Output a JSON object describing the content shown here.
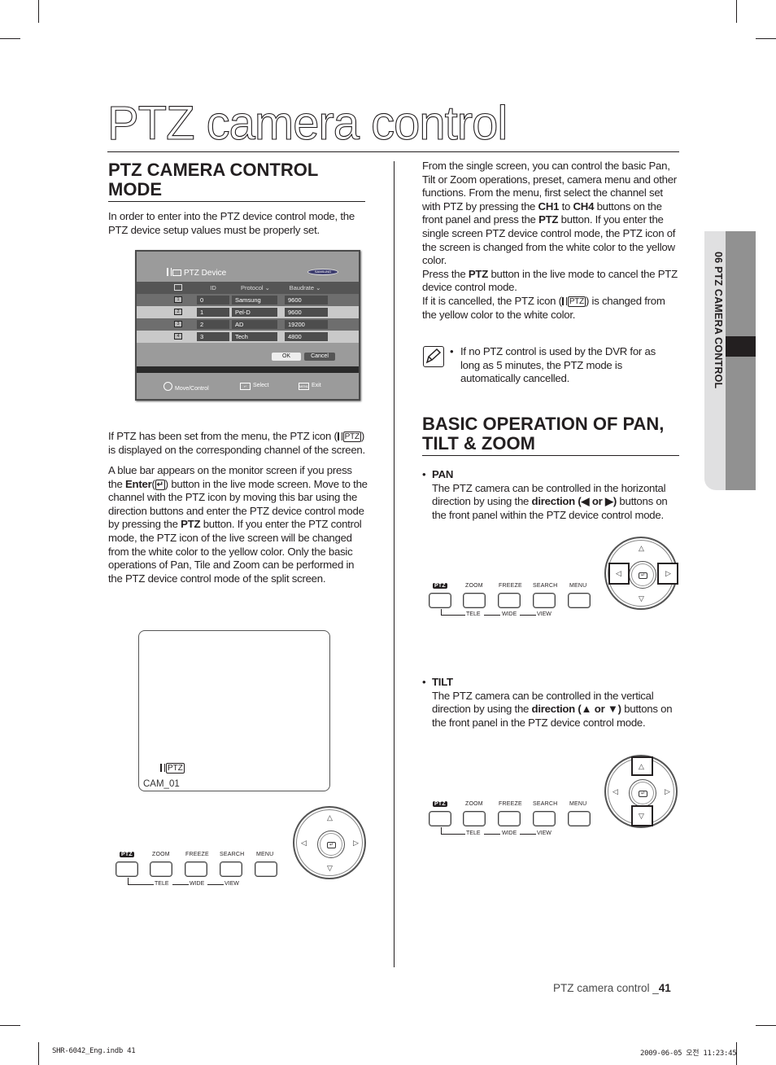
{
  "page_title": "PTZ camera control",
  "side_tab": "06 PTZ CAMERA CONTROL",
  "left": {
    "heading_line1": "PTZ CAMERA CONTROL",
    "heading_line2": "MODE",
    "intro": "In order to enter into the PTZ device control mode, the PTZ device setup values must be properly set.",
    "osd": {
      "title": "PTZ Device",
      "logo": "SAMSUNG",
      "columns": [
        "ID",
        "Protocol ⌄",
        "Baudrate ⌄"
      ],
      "rows": [
        {
          "channel": "1",
          "id": "0",
          "protocol": "Samsung",
          "baudrate": "9600"
        },
        {
          "channel": "2",
          "id": "1",
          "protocol": "Pel-D",
          "baudrate": "9600"
        },
        {
          "channel": "3",
          "id": "2",
          "protocol": "AD",
          "baudrate": "19200"
        },
        {
          "channel": "4",
          "id": "3",
          "protocol": "Tech",
          "baudrate": "4800"
        }
      ],
      "ok_label": "OK",
      "cancel_label": "Cancel",
      "footer": {
        "move": "Move/Control",
        "select": "Select",
        "exit": "Exit",
        "menu_key": "MENU"
      }
    },
    "para1_a": "If PTZ has been set from the menu, the PTZ icon (",
    "para1_b": ") is displayed on the corresponding channel of the screen.",
    "para2_a": "A blue bar appears on the monitor screen if you press the ",
    "para2_enter": "Enter",
    "para2_b": ") button in the live mode screen. Move to the channel with the PTZ icon by moving this bar using the direction buttons and enter the PTZ device control mode by pressing the ",
    "para2_ptz": "PTZ",
    "para2_c": " button. If you enter the PTZ control mode, the PTZ icon of the live screen will be changed from the white color to the yellow color. Only the basic operations of Pan, Tile and Zoom can be performed in the PTZ device control mode of the split screen.",
    "cam_label": "CAM_01",
    "ptz_icon_label": "PTZ"
  },
  "right": {
    "p1_a": "From the single screen, you can control the basic Pan, Tilt or Zoom operations, preset, camera menu and other functions. From the menu, first select the channel set with PTZ by pressing the ",
    "p1_ch1": "CH1",
    "p1_to": " to ",
    "p1_ch4": "CH4",
    "p1_b": " buttons on the front panel and press the ",
    "p1_ptz": "PTZ",
    "p1_c": " button. If you enter the single screen PTZ device control mode, the PTZ icon of the screen is changed from the white color to the yellow color.",
    "p2_a": "Press the ",
    "p2_ptz": "PTZ",
    "p2_b": " button in the live mode to cancel the  PTZ device control mode.",
    "p3_a": "If it is cancelled, the PTZ icon (",
    "p3_b": ") is changed from the yellow color to the white color.",
    "note": "If no PTZ control is used by the DVR for as long as 5 minutes, the PTZ mode is automatically cancelled.",
    "heading_line1": "BASIC OPERATION OF PAN,",
    "heading_line2": "TILT & ZOOM",
    "pan_title": "PAN",
    "pan_a": "The PTZ camera can be controlled in the horizontal direction by using the ",
    "pan_bold": "direction",
    "pan_keys": "(◀ or ▶)",
    "pan_b": " buttons on the front panel within the PTZ device control mode.",
    "tilt_title": "TILT",
    "tilt_a": "The PTZ camera can be controlled in the vertical direction by using the ",
    "tilt_bold": "direction",
    "tilt_keys": "(▲ or ▼)",
    "tilt_b": " buttons on the front panel in the PTZ device control mode."
  },
  "front_panel": {
    "buttons": [
      "PTZ",
      "ZOOM",
      "FREEZE",
      "SEARCH",
      "MENU"
    ],
    "sub_labels": [
      "TELE",
      "WIDE",
      "VIEW"
    ]
  },
  "footer": {
    "page_text": "PTZ camera control _",
    "page_number": "41",
    "slug_left": "SHR-6042_Eng.indb   41",
    "slug_right": "2009-06-05   오전 11:23:45"
  }
}
